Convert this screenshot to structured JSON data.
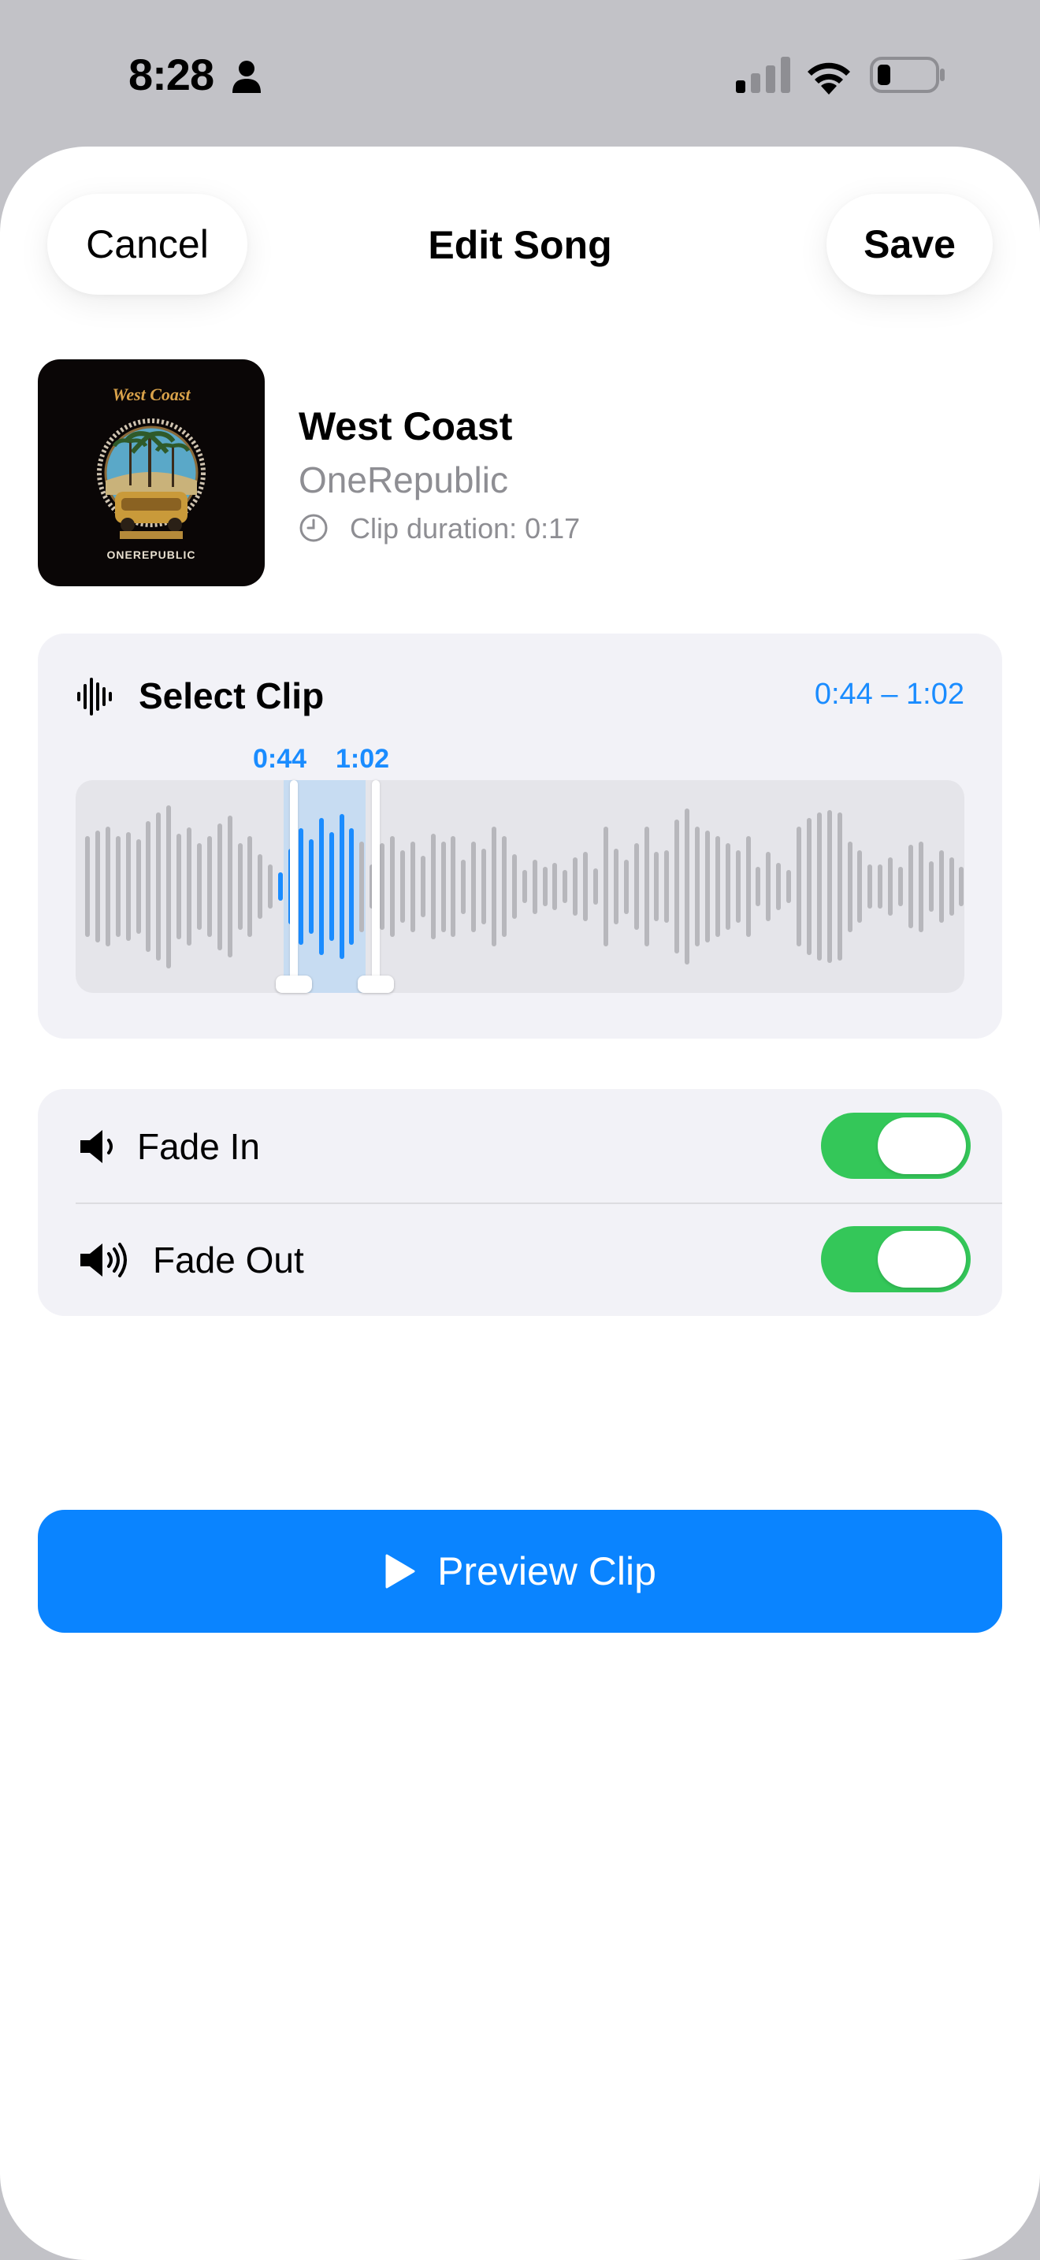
{
  "status_bar": {
    "time": "8:28",
    "icons": [
      "person-icon",
      "cellular-signal-icon",
      "wifi-icon",
      "battery-icon"
    ]
  },
  "header": {
    "cancel_label": "Cancel",
    "title": "Edit Song",
    "save_label": "Save"
  },
  "song": {
    "artwork": {
      "title_text": "West Coast",
      "artist_text": "ONEREPUBLIC"
    },
    "title": "West Coast",
    "artist": "OneRepublic",
    "clip_duration": "Clip duration: 0:17"
  },
  "clip_selector": {
    "title": "Select Clip",
    "range": "0:44 – 1:02",
    "start_label": "0:44",
    "end_label": "1:02",
    "waveform_levels": [
      0.56,
      0.62,
      0.66,
      0.56,
      0.6,
      0.52,
      0.72,
      0.82,
      0.9,
      0.58,
      0.65,
      0.48,
      0.56,
      0.7,
      0.78,
      0.48,
      0.56,
      0.36,
      0.24,
      0.16,
      0.42,
      0.64,
      0.52,
      0.76,
      0.6,
      0.8,
      0.64,
      0.5,
      0.24,
      0.48,
      0.56,
      0.4,
      0.5,
      0.34,
      0.58,
      0.5,
      0.56,
      0.3,
      0.5,
      0.42,
      0.66,
      0.56,
      0.36,
      0.18,
      0.3,
      0.22,
      0.26,
      0.18,
      0.32,
      0.38,
      0.2,
      0.66,
      0.42,
      0.3,
      0.48,
      0.66,
      0.38,
      0.4,
      0.74,
      0.86,
      0.66,
      0.62,
      0.56,
      0.48,
      0.4,
      0.56,
      0.22,
      0.38,
      0.26,
      0.18,
      0.66,
      0.76,
      0.82,
      0.84,
      0.82,
      0.5,
      0.4,
      0.24,
      0.24,
      0.32,
      0.22,
      0.46,
      0.5,
      0.28,
      0.4,
      0.32,
      0.22
    ],
    "selected_from_index": 19,
    "selected_to_index": 26,
    "colors": {
      "selected": "#1a8cff",
      "unselected": "#b7b7bc"
    }
  },
  "fade": {
    "fade_in_label": "Fade In",
    "fade_in_on": true,
    "fade_out_label": "Fade Out",
    "fade_out_on": true,
    "toggle_color": "#34c759"
  },
  "preview": {
    "label": "Preview Clip",
    "color": "#0a84ff"
  }
}
